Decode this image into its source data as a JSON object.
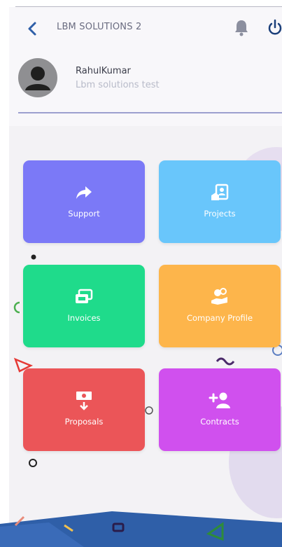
{
  "header": {
    "title": "LBM SOLUTIONS 2",
    "icons": {
      "back": "chevron-left",
      "notifications": "bell",
      "logout": "power"
    }
  },
  "profile": {
    "name": "RahulKumar",
    "company": "Lbm solutions test",
    "avatar_icon": "user-silhouette"
  },
  "tiles": [
    {
      "label": "Support",
      "icon": "share-arrow",
      "color": "#7b79f7"
    },
    {
      "label": "Projects",
      "icon": "id-card",
      "color": "#69c6fb"
    },
    {
      "label": "Invoices",
      "icon": "invoice-cards",
      "color": "#1fdb8b"
    },
    {
      "label": "Company Profile",
      "icon": "hand-coins",
      "color": "#fdb54b"
    },
    {
      "label": "Proposals",
      "icon": "cash-down",
      "color": "#eb5558"
    },
    {
      "label": "Contracts",
      "icon": "add-user",
      "color": "#d050ee"
    }
  ],
  "colors": {
    "background": "#f3f2f5",
    "accent": "#2f5fa8",
    "divider": "#9c9fcf"
  }
}
